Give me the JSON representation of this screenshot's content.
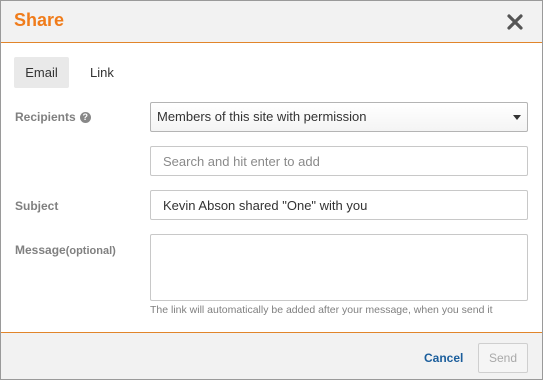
{
  "dialog": {
    "title": "Share",
    "close_icon": "close-icon"
  },
  "tabs": [
    {
      "label": "Email",
      "active": true
    },
    {
      "label": "Link",
      "active": false
    }
  ],
  "form": {
    "recipients_label": "Recipients",
    "help_icon": "question-circle-icon",
    "recipients_select_value": "Members of this site with permission",
    "search_placeholder": "Search and hit enter to add",
    "subject_label": "Subject",
    "subject_value": "Kevin Abson shared \"One\" with you",
    "message_label": "Message",
    "message_optional": "(optional)",
    "message_value": "",
    "hint": "The link will automatically be added after your message, when you send it"
  },
  "footer": {
    "cancel_label": "Cancel",
    "send_label": "Send"
  },
  "colors": {
    "accent": "#f07c1b",
    "link": "#1b5e9c"
  }
}
